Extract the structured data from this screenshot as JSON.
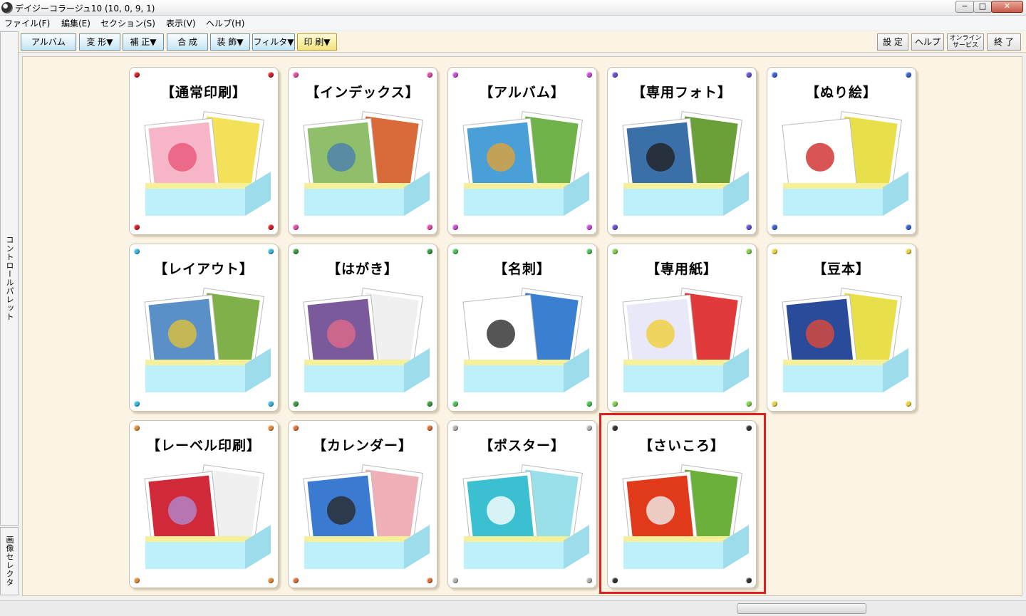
{
  "window": {
    "title": "デイジーコラージュ10 (10, 0, 9, 1)",
    "minimize": "−",
    "maximize": "□",
    "close": "✕"
  },
  "menu": [
    "ファイル(F)",
    "編集(E)",
    "セクション(S)",
    "表示(V)",
    "ヘルプ(H)"
  ],
  "toolbar": {
    "left": [
      "アルバム",
      "変 形▼",
      "補 正▼",
      "合 成",
      "装 飾▼",
      "フィルタ▼",
      "印 刷▼"
    ],
    "right": [
      "設 定",
      "ヘルプ",
      "オンライン サービス",
      "終 了"
    ],
    "active": "印 刷▼"
  },
  "sidebar": {
    "control_palette": "コントロールパレット",
    "image_selector": "画像セレクタ"
  },
  "cards": [
    {
      "title": "【通常印刷】",
      "dot_color": "#d4202a",
      "icon": "photo-print-icon"
    },
    {
      "title": "【インデックス】",
      "dot_color": "#e34fa6",
      "icon": "index-print-icon"
    },
    {
      "title": "【アルバム】",
      "dot_color": "#c84fd6",
      "icon": "album-print-icon"
    },
    {
      "title": "【専用フォト】",
      "dot_color": "#6b4fd6",
      "icon": "special-photo-icon"
    },
    {
      "title": "【ぬり絵】",
      "dot_color": "#3a63d6",
      "icon": "coloring-icon"
    },
    {
      "title": "【レイアウト】",
      "dot_color": "#38b5e0",
      "icon": "layout-icon"
    },
    {
      "title": "【はがき】",
      "dot_color": "#3e9a42",
      "icon": "postcard-icon"
    },
    {
      "title": "【名刺】",
      "dot_color": "#4bbf5a",
      "icon": "business-card-icon"
    },
    {
      "title": "【専用紙】",
      "dot_color": "#7fcf4a",
      "icon": "special-paper-icon"
    },
    {
      "title": "【豆本】",
      "dot_color": "#e6d23a",
      "icon": "mini-book-icon"
    },
    {
      "title": "【レーベル印刷】",
      "dot_color": "#e08a36",
      "icon": "label-print-icon"
    },
    {
      "title": "【カレンダー】",
      "dot_color": "#e0703a",
      "icon": "calendar-icon"
    },
    {
      "title": "【ポスター】",
      "dot_color": "#b0b0b0",
      "icon": "poster-icon"
    },
    {
      "title": "【さいころ】",
      "dot_color": "#333333",
      "icon": "dice-icon"
    }
  ],
  "selected_card": "【さいころ】"
}
